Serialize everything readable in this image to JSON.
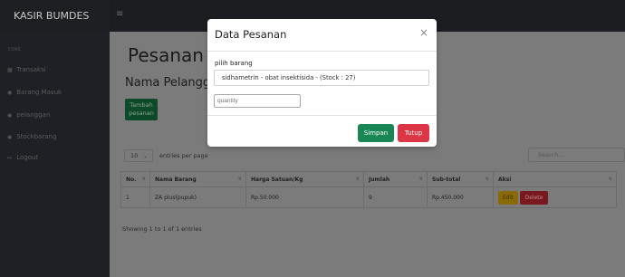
{
  "brand": "KASIR BUMDES",
  "menu_toggle": "≡",
  "sidebar": {
    "heading": "CORE",
    "items": [
      {
        "icon": "chart-icon",
        "glyph": "▦",
        "label": "Transaksi"
      },
      {
        "icon": "tachometer-icon",
        "glyph": "◉",
        "label": "Barang Masuk"
      },
      {
        "icon": "tachometer-icon",
        "glyph": "◉",
        "label": "pelanggan"
      },
      {
        "icon": "tachometer-icon",
        "glyph": "◉",
        "label": "Stockbarang"
      },
      {
        "icon": "logout-icon",
        "glyph": "↦",
        "label": "Logout"
      }
    ]
  },
  "main": {
    "title": "Pesanan :",
    "section_title": "Nama Pelangga",
    "add_button": "Tambah pesanan",
    "entries_select": "10",
    "entries_label": "entries per page",
    "search_placeholder": "Search...",
    "table": {
      "headers": [
        "No.",
        "Nama Barang",
        "Harga Satuan/Kg",
        "Jumlah",
        "Sub-total",
        "Aksi"
      ],
      "rows": [
        {
          "no": "1",
          "nama": "ZA plus(pupuk)",
          "harga": "Rp.50.000",
          "jumlah": "9",
          "subtotal": "Rp.450.000"
        }
      ],
      "edit_label": "Edit",
      "delete_label": "Delete"
    },
    "showing": "Showing 1 to 1 of 1 entries"
  },
  "modal": {
    "title": "Data Pesanan",
    "close": "×",
    "select_label": "pilih barang",
    "select_value": "sidhametrin - obat insektisida - (Stock : 27)",
    "quantity_placeholder": "quantity",
    "save": "Simpan",
    "close_button": "Tutup"
  },
  "colors": {
    "save": "#198754",
    "close": "#dc3545",
    "add_button": "#198754",
    "edit": "#ffc107",
    "delete": "#dc3545"
  }
}
